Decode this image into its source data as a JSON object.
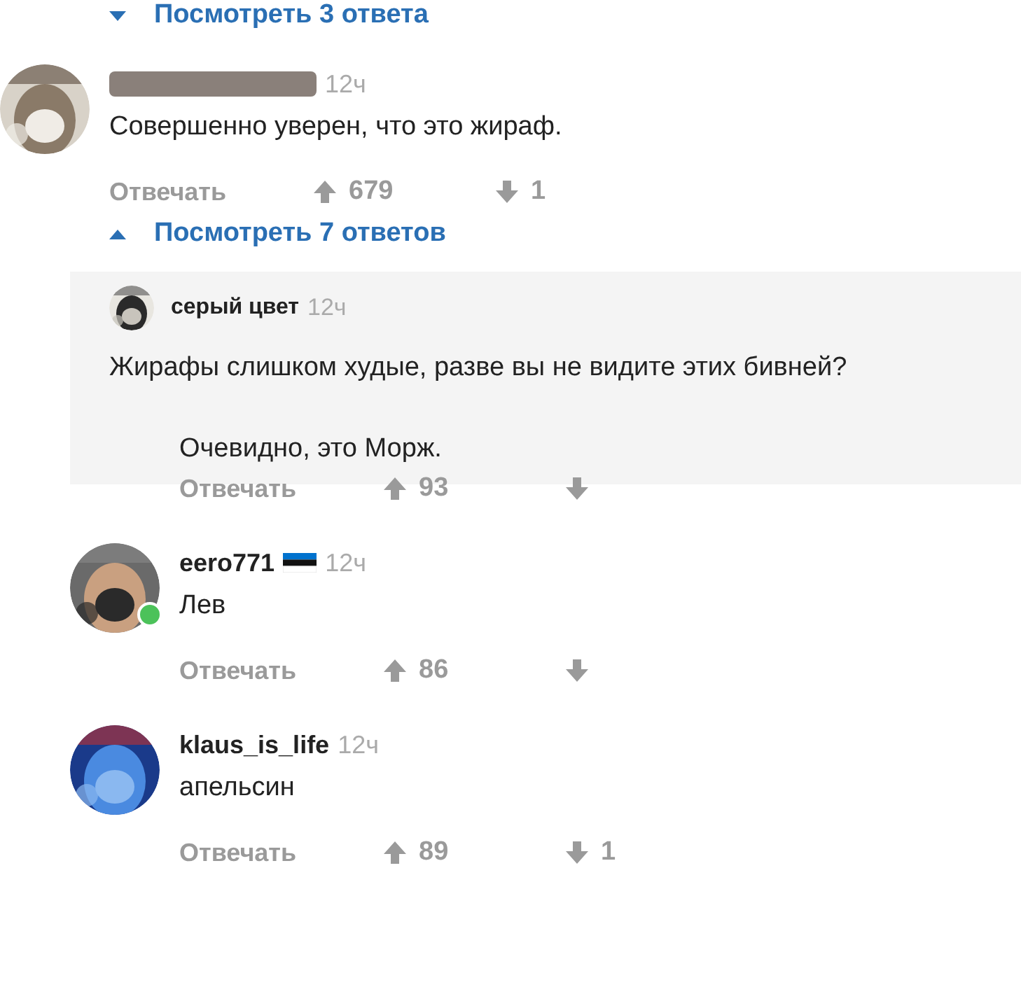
{
  "top_toggle": {
    "label": "Посмотреть 3 ответа",
    "expanded": false
  },
  "comments": [
    {
      "kind": "regular",
      "author_redacted": true,
      "time": "12ч",
      "paragraphs": [
        "Совершенно уверен, что это жираф."
      ],
      "reply_label": "Отвечать",
      "upvotes": "679",
      "downvotes": "1",
      "replies_toggle": {
        "label": "Посмотреть 7 ответов",
        "expanded": true
      },
      "replies": [
        {
          "kind": "compact",
          "author": "серый цвет",
          "time": "12ч",
          "paragraphs": [
            "Жирафы слишком худые, разве вы не видите этих бивней?",
            "Очевидно, это Морж."
          ],
          "reply_label": "Отвечать",
          "upvotes": "93"
        },
        {
          "kind": "regular",
          "author": "eero771",
          "flag": true,
          "online": true,
          "time": "12ч",
          "paragraphs": [
            "Лев"
          ],
          "reply_label": "Отвечать",
          "upvotes": "86"
        },
        {
          "kind": "regular",
          "author": "klaus_is_life",
          "time": "12ч",
          "paragraphs": [
            "апельсин"
          ],
          "reply_label": "Отвечать",
          "upvotes": "89",
          "downvotes": "1"
        }
      ]
    }
  ]
}
